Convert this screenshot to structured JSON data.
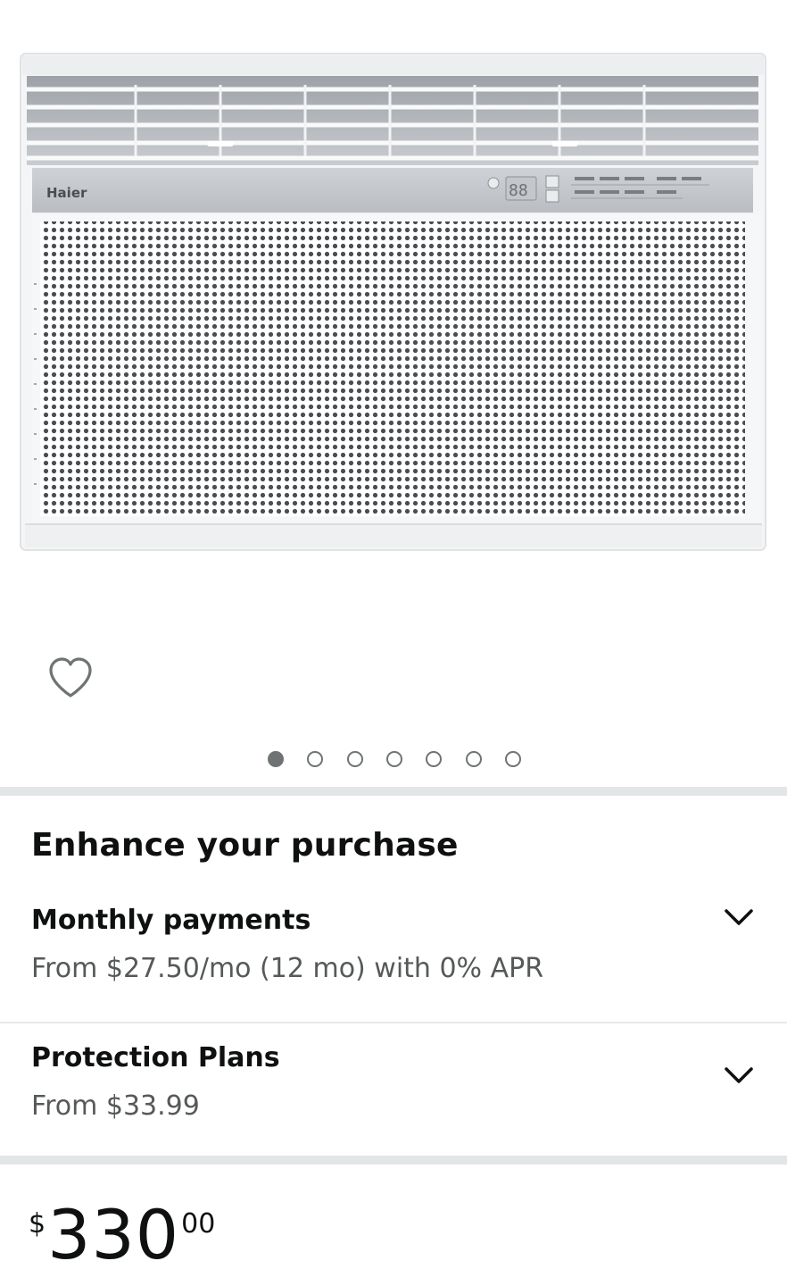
{
  "product": {
    "image_alt": "Haier window air conditioner",
    "brand_mark": "Haier",
    "display_readout": "88"
  },
  "carousel": {
    "count": 7,
    "active_index": 0
  },
  "enhance": {
    "title": "Enhance your purchase",
    "monthly": {
      "title": "Monthly payments",
      "subtitle": "From $27.50/mo (12 mo) with 0% APR"
    },
    "protection": {
      "title": "Protection Plans",
      "subtitle": "From $33.99"
    }
  },
  "price": {
    "symbol": "$",
    "whole": "330",
    "fraction": "00"
  },
  "colors": {
    "text": "#0f1111",
    "secondary_text": "#565959",
    "divider": "#e3e6e6",
    "dot": "#6f7373"
  },
  "icons": {
    "wishlist": "heart-outline-icon",
    "expand": "chevron-down-icon"
  }
}
